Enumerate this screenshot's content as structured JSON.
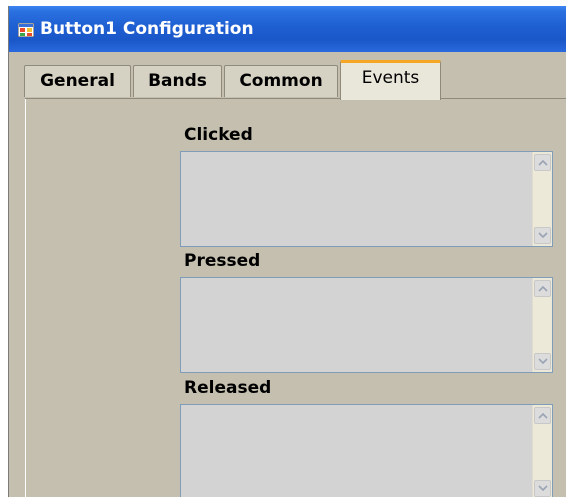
{
  "window": {
    "title": "Button1 Configuration"
  },
  "tabs": [
    {
      "label": "General",
      "active": false
    },
    {
      "label": "Bands",
      "active": false
    },
    {
      "label": "Common",
      "active": false
    },
    {
      "label": "Events",
      "active": true
    }
  ],
  "events": {
    "clicked_label": "Clicked",
    "clicked_value": "",
    "pressed_label": "Pressed",
    "pressed_value": "",
    "released_label": "Released",
    "released_value": ""
  },
  "icons": {
    "title": "app-window-icon",
    "scroll_up": "chevron-up-icon",
    "scroll_down": "chevron-down-icon"
  },
  "colors": {
    "titlebar": "#1e5fd2",
    "dialog_bg": "#c4bfae",
    "active_tab_accent": "#f5a623",
    "textbox_bg": "#d3d3d3",
    "textbox_border": "#7f9db9"
  }
}
